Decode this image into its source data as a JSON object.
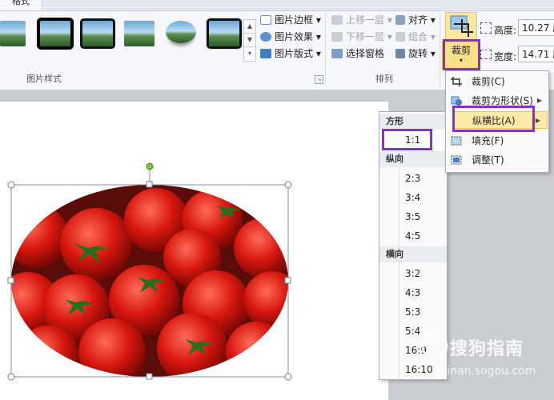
{
  "ribbon": {
    "active_tab": "格式",
    "picture_style_buttons": {
      "border": "图片边框",
      "effects": "图片效果",
      "layout": "图片版式"
    },
    "group_picture_styles": "图片样式",
    "arrange": {
      "bring_forward": "上移一层",
      "send_backward": "下移一层",
      "selection_pane": "选择窗格",
      "align": "对齐",
      "group": "组合",
      "rotate": "旋转"
    },
    "group_arrange": "排列",
    "crop_label": "裁剪",
    "size": {
      "height_label": "高度:",
      "height_value": "10.27 厘",
      "width_label": "宽度:",
      "width_value": "14.71 厘"
    }
  },
  "crop_menu": {
    "items": [
      {
        "label": "裁剪(C)",
        "icon": "crop-icon"
      },
      {
        "label": "裁剪为形状(S)",
        "icon": "shape-icon"
      },
      {
        "label": "纵横比(A)",
        "icon": "aspect-icon"
      },
      {
        "label": "填充(F)",
        "icon": "fill-icon"
      },
      {
        "label": "调整(T)",
        "icon": "fit-icon"
      }
    ]
  },
  "aspect_submenu": {
    "sections": [
      {
        "heading": "方形",
        "items": [
          "1:1"
        ]
      },
      {
        "heading": "纵向",
        "items": [
          "2:3",
          "3:4",
          "3:5",
          "4:5"
        ]
      },
      {
        "heading": "横向",
        "items": [
          "3:2",
          "4:3",
          "5:3",
          "5:4",
          "16:9",
          "16:10"
        ]
      }
    ]
  },
  "watermark": {
    "text": "搜狗指南",
    "url": "zhinan.sogou.com"
  },
  "colors": {
    "highlight": "#8b2fc9",
    "menu_active": "#fde9a8",
    "handle_green": "#7dc242"
  }
}
